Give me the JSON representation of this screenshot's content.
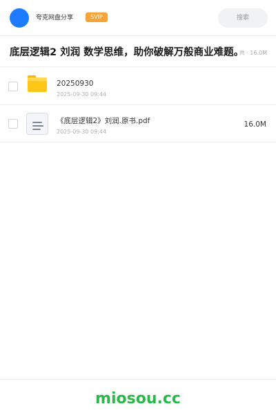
{
  "header": {
    "share_name": "夸克网盘分享",
    "badge": "SVIP",
    "search_placeholder": "搜索"
  },
  "share": {
    "title": "底层逻辑2 刘润 数学思维，助你破解万般商业难题。",
    "meta": "共 · 16.0M"
  },
  "files": [
    {
      "name": "20250930",
      "date": "2025-09-30 09:44",
      "size": "",
      "icon": "folder-icon"
    },
    {
      "name": "《底层逻辑2》刘润.原书.pdf",
      "date": "2025-09-30 09:44",
      "size": "16.0M",
      "icon": "document-icon"
    }
  ],
  "footer": {
    "brand": "miosou.cc"
  },
  "colors": {
    "accent": "#1e7bff",
    "badge": "#f7a338",
    "folder": "#ffc61a",
    "brand": "#2ab84a"
  }
}
